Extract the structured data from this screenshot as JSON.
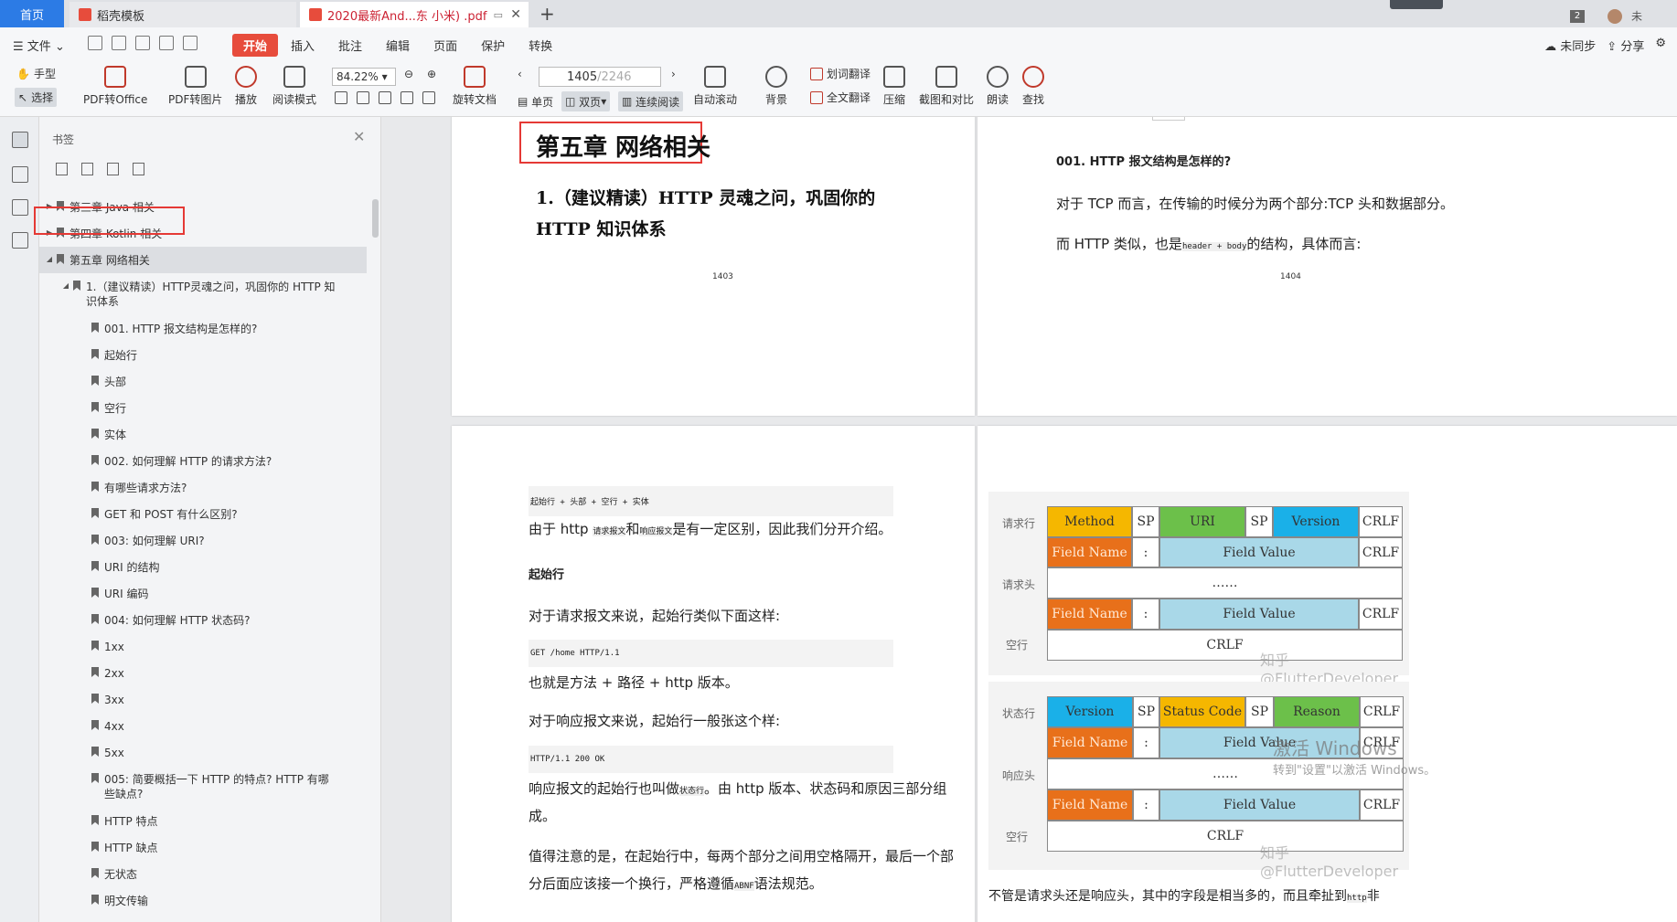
{
  "tabs": {
    "home": "首页",
    "tab1": "稻壳模板",
    "tab2": "2020最新And...东 小米) .pdf",
    "badge": "2",
    "user": "未"
  },
  "menu": {
    "file": "文件",
    "items": [
      "开始",
      "插入",
      "批注",
      "编辑",
      "页面",
      "保护",
      "转换"
    ],
    "sync": "未同步",
    "share": "分享"
  },
  "ribbon": {
    "hand": "手型",
    "select": "选择",
    "pdf2office": "PDF转Office",
    "pdf2img": "PDF转图片",
    "play": "播放",
    "readmode": "阅读模式",
    "zoom": "84.22%",
    "rotate": "旋转文档",
    "page_current": "1405",
    "page_total": "/2246",
    "single": "单页",
    "double": "双页",
    "continuous": "连续阅读",
    "autoscroll": "自动滚动",
    "background": "背景",
    "word_translate": "划词翻译",
    "full_translate": "全文翻译",
    "compress": "压缩",
    "screenshot": "截图和对比",
    "read_aloud": "朗读",
    "find": "查找"
  },
  "panel": {
    "title": "书签",
    "items": [
      {
        "label": "第三章 Java 相关",
        "level": 0,
        "arrow": "▶"
      },
      {
        "label": "第四章 Kotlin 相关",
        "level": 0,
        "arrow": "▶"
      },
      {
        "label": "第五章 网络相关",
        "level": 0,
        "arrow": "◢"
      },
      {
        "label": "1.（建议精读）HTTP灵魂之问，巩固你的 HTTP 知识体系",
        "level": 1,
        "arrow": "◢"
      },
      {
        "label": "001. HTTP 报文结构是怎样的?",
        "level": 2
      },
      {
        "label": "起始行",
        "level": 2
      },
      {
        "label": "头部",
        "level": 2
      },
      {
        "label": "空行",
        "level": 2
      },
      {
        "label": "实体",
        "level": 2
      },
      {
        "label": "002. 如何理解 HTTP 的请求方法?",
        "level": 2
      },
      {
        "label": "有哪些请求方法?",
        "level": 2
      },
      {
        "label": "GET 和 POST 有什么区别?",
        "level": 2
      },
      {
        "label": "003: 如何理解 URI?",
        "level": 2
      },
      {
        "label": "URI 的结构",
        "level": 2
      },
      {
        "label": "URI 编码",
        "level": 2
      },
      {
        "label": "004: 如何理解 HTTP 状态码?",
        "level": 2
      },
      {
        "label": "1xx",
        "level": 2
      },
      {
        "label": "2xx",
        "level": 2
      },
      {
        "label": "3xx",
        "level": 2
      },
      {
        "label": "4xx",
        "level": 2
      },
      {
        "label": "5xx",
        "level": 2
      },
      {
        "label": "005: 简要概括一下 HTTP 的特点? HTTP 有哪些缺点?",
        "level": 2
      },
      {
        "label": "HTTP 特点",
        "level": 2
      },
      {
        "label": "HTTP 缺点",
        "level": 2
      },
      {
        "label": "无状态",
        "level": 2
      },
      {
        "label": "明文传输",
        "level": 2
      }
    ]
  },
  "page1403": {
    "chapter": "第五章 网络相关",
    "section": "1.（建议精读）HTTP 灵魂之问，巩固你的 HTTP 知识体系",
    "page_no": "1403"
  },
  "page1404": {
    "heading": "001. HTTP 报文结构是怎样的?",
    "p1": "对于 TCP 而言，在传输的时候分为两个部分:TCP 头和数据部分。",
    "p2a": "而 HTTP 类似，也是",
    "p2code": "header + body",
    "p2b": "的结构，具体而言:",
    "page_no": "1404"
  },
  "page1405": {
    "code1": "起始行 + 头部 + 空行 + 实体",
    "p1a": "由于 http ",
    "p1c1": "请求报文",
    "p1b": "和",
    "p1c2": "响应报文",
    "p1d": "是有一定区别，因此我们分开介绍。",
    "h_start": "起始行",
    "p2": "对于请求报文来说，起始行类似下面这样:",
    "code2": "GET /home HTTP/1.1",
    "p3": "也就是方法 + 路径 + http 版本。",
    "p4": "对于响应报文来说，起始行一般张这个样:",
    "code3": "HTTP/1.1 200 OK",
    "p5a": "响应报文的起始行也叫做",
    "p5code": "状态行",
    "p5b": "。由 http 版本、状态码和原因三部分组",
    "p5c": "成。",
    "p6a": "值得注意的是，在起始行中，每两个部分之间用空格隔开，最后一个部",
    "p6b": "分后面应该接一个换行，严格遵循",
    "p6code": "ABNF",
    "p6c": "语法规范。"
  },
  "page1406": {
    "req": {
      "label_line": "请求行",
      "label_head": "请求头",
      "label_blank": "空行",
      "line": [
        "Method",
        "SP",
        "URI",
        "SP",
        "Version",
        "CRLF"
      ],
      "field_name": "Field Name",
      "colon": ":",
      "field_value": "Field Value",
      "crlf": "CRLF",
      "dots": "……"
    },
    "res": {
      "label_line": "状态行",
      "label_head": "响应头",
      "label_blank": "空行",
      "line": [
        "Version",
        "SP",
        "Status Code",
        "SP",
        "Reason",
        "CRLF"
      ],
      "field_name": "Field Name",
      "colon": ":",
      "field_value": "Field Value",
      "crlf": "CRLF",
      "dots": "……"
    },
    "watermark": "知乎 @FlutterDeveloper",
    "p_bottom_a": "不管是请求头还是响应头，其中的字段是相当多的，而且牵扯到",
    "p_bottom_code": "http",
    "p_bottom_b": "非"
  },
  "windows": {
    "title": "激活 Windows",
    "sub": "转到\"设置\"以激活 Windows。"
  }
}
